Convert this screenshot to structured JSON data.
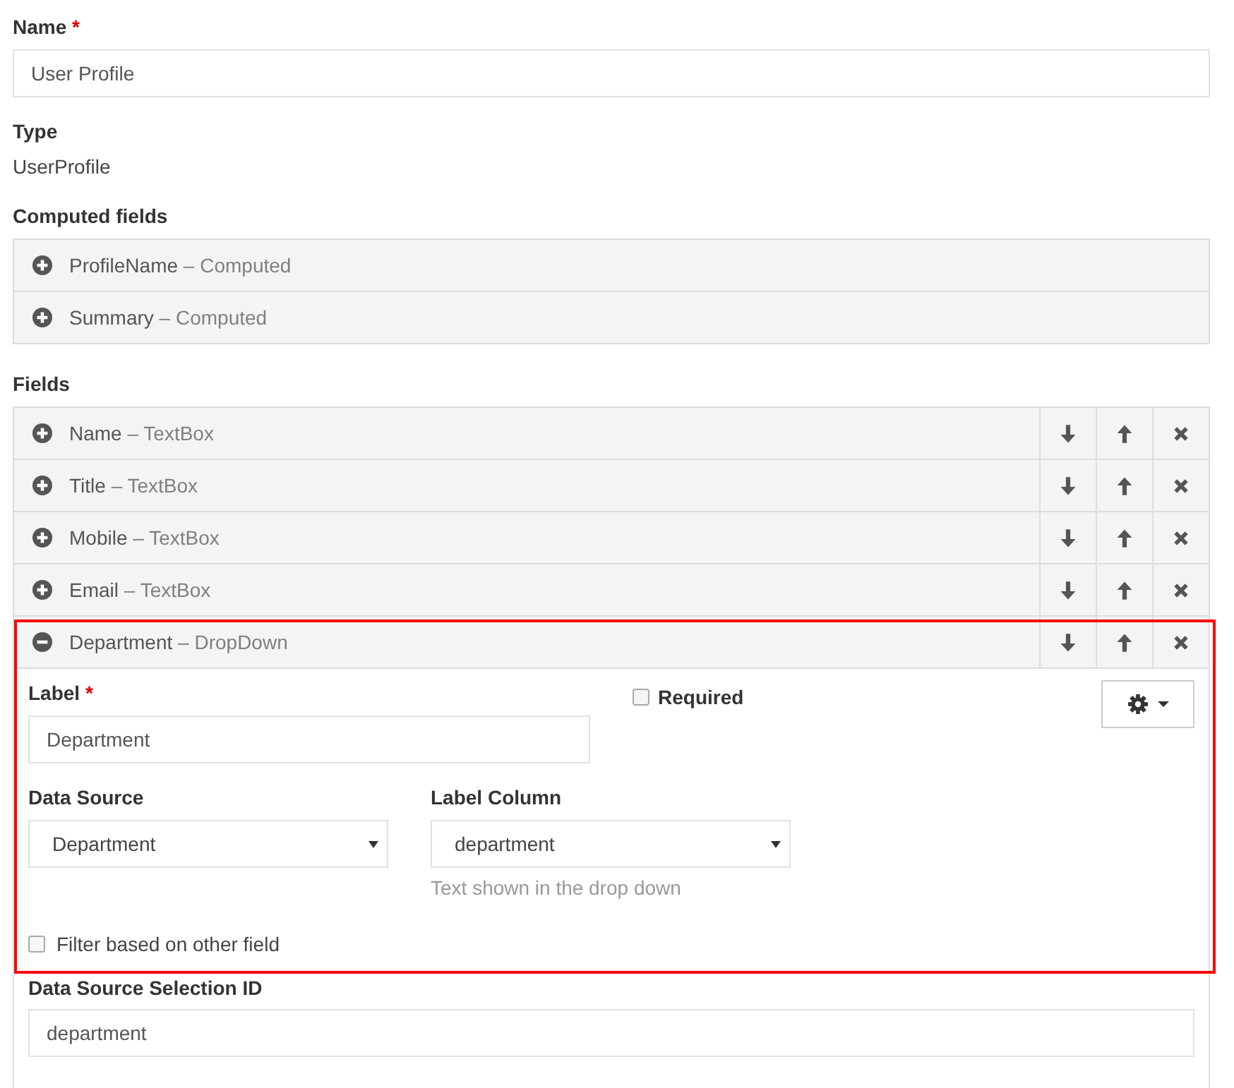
{
  "name_field": {
    "label": "Name",
    "required_mark": "*",
    "value": "User Profile"
  },
  "type_field": {
    "label": "Type",
    "value": "UserProfile"
  },
  "computed_fields": {
    "label": "Computed fields",
    "items": [
      {
        "name": "ProfileName",
        "type": "– Computed",
        "expanded": false
      },
      {
        "name": "Summary",
        "type": "– Computed",
        "expanded": false
      }
    ]
  },
  "fields": {
    "label": "Fields",
    "items": [
      {
        "name": "Name",
        "type": "– TextBox",
        "expanded": false,
        "highlighted": false
      },
      {
        "name": "Title",
        "type": "– TextBox",
        "expanded": false,
        "highlighted": false
      },
      {
        "name": "Mobile",
        "type": "– TextBox",
        "expanded": false,
        "highlighted": false
      },
      {
        "name": "Email",
        "type": "– TextBox",
        "expanded": false,
        "highlighted": false
      },
      {
        "name": "Department",
        "type": "– DropDown",
        "expanded": true,
        "highlighted": true,
        "details": {
          "label_field": {
            "label": "Label",
            "required_mark": "*",
            "value": "Department"
          },
          "required": {
            "label": "Required",
            "checked": false
          },
          "data_source": {
            "label": "Data Source",
            "value": "Department"
          },
          "label_column": {
            "label": "Label Column",
            "value": "department",
            "help": "Text shown in the drop down"
          },
          "filter": {
            "label": "Filter based on other field",
            "checked": false
          },
          "selection_id": {
            "label": "Data Source Selection ID",
            "value": "department"
          }
        }
      }
    ]
  }
}
